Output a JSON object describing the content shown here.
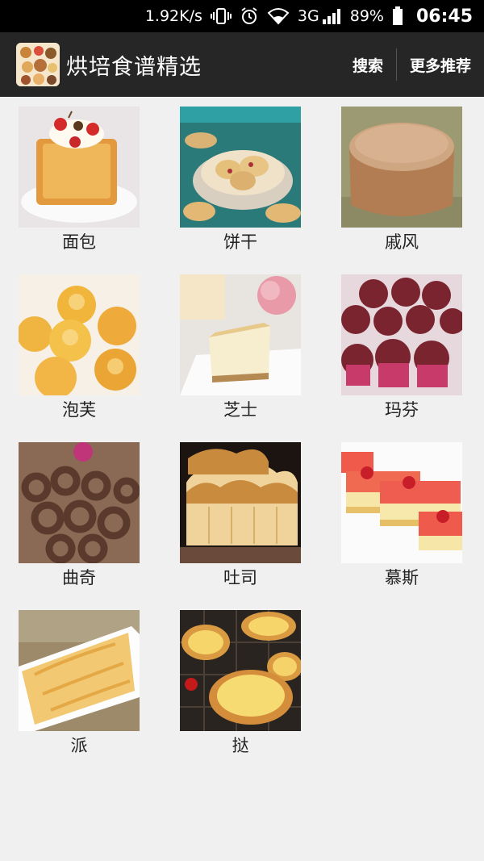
{
  "status": {
    "speed": "1.92K/s",
    "network": "3G",
    "battery": "89%",
    "time": "06:45"
  },
  "appbar": {
    "title": "烘培食谱精选",
    "search_label": "搜索",
    "more_label": "更多推荐"
  },
  "categories": [
    {
      "label": "面包"
    },
    {
      "label": "饼干"
    },
    {
      "label": "戚风"
    },
    {
      "label": "泡芙"
    },
    {
      "label": "芝士"
    },
    {
      "label": "玛芬"
    },
    {
      "label": "曲奇"
    },
    {
      "label": "吐司"
    },
    {
      "label": "慕斯"
    },
    {
      "label": "派"
    },
    {
      "label": "挞"
    }
  ]
}
